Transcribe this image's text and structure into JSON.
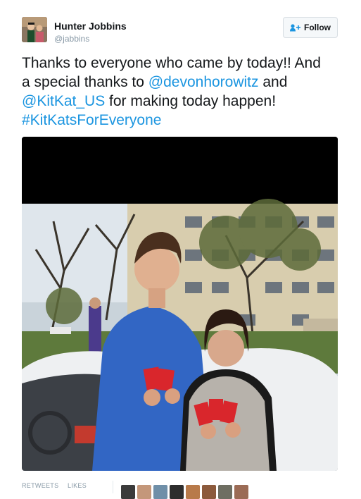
{
  "tweet": {
    "author": {
      "name": "Hunter Jobbins",
      "handle": "@jabbins"
    },
    "follow_label": "Follow",
    "text_lines": [
      [
        {
          "text": "Thanks to everyone who came by today!! And"
        }
      ],
      [
        {
          "text": "a special thanks to "
        },
        {
          "text": "@devonhorowitz",
          "link": true
        },
        {
          "text": " and"
        }
      ],
      [
        {
          "text": "@KitKat_US",
          "link": true
        },
        {
          "text": " for making today happen!"
        }
      ],
      [
        {
          "text": "#KitKatsForEveryone",
          "link": true
        }
      ]
    ],
    "media": {
      "subject": "Two people holding KitKat bars in front of a car and building"
    },
    "stats": {
      "retweets_label": "RETWEETS",
      "likes_label": "LIKES"
    },
    "likers_count": 8
  },
  "colors": {
    "link": "#1b95e0",
    "muted": "#8899a6",
    "text": "#14171a"
  },
  "icons": {
    "follow": "add-user-icon"
  }
}
